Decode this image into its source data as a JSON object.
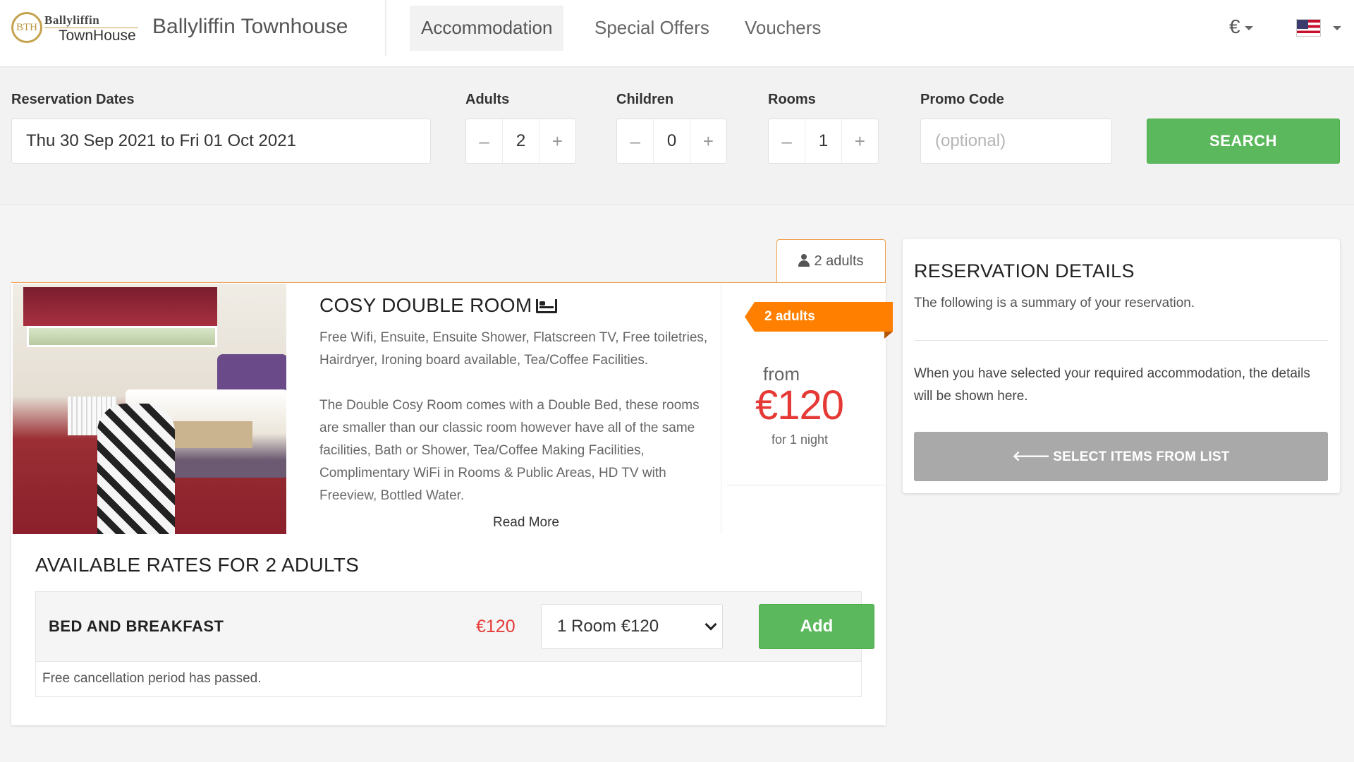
{
  "header": {
    "logo_line1": "Ballyliffin",
    "logo_line2": "TownHouse",
    "logo_seal": "BTH",
    "site_name": "Ballyliffin Townhouse",
    "nav": [
      {
        "label": "Accommodation",
        "active": true
      },
      {
        "label": "Special Offers",
        "active": false
      },
      {
        "label": "Vouchers",
        "active": false
      }
    ],
    "currency": "€",
    "language_icon": "us-flag-icon"
  },
  "search": {
    "dates_label": "Reservation Dates",
    "dates_value": "Thu 30 Sep 2021 to Fri 01 Oct 2021",
    "adults_label": "Adults",
    "adults_value": "2",
    "children_label": "Children",
    "children_value": "0",
    "rooms_label": "Rooms",
    "rooms_value": "1",
    "minus_glyph": "–",
    "plus_glyph": "+",
    "promo_label": "Promo Code",
    "promo_placeholder": "(optional)",
    "promo_value": "",
    "search_button": "SEARCH"
  },
  "room": {
    "occupancy_tab": "2 adults",
    "title": "COSY DOUBLE ROOM",
    "amenities": "Free Wifi, Ensuite, Ensuite Shower, Flatscreen TV, Free toiletries, Hairdryer, Ironing board available, Tea/Coffee Facilities.",
    "description": "The Double Cosy Room comes with a Double Bed, these rooms are smaller than our classic room however have all of the same facilities, Bath or Shower, Tea/Coffee Making Facilities, Complimentary WiFi in Rooms & Public Areas, HD TV with Freeview, Bottled Water.",
    "read_more": "Read More",
    "ribbon": "2 adults",
    "from_label": "from",
    "price": "€120",
    "night_label": "for 1 night",
    "rates_title": "AVAILABLE RATES FOR 2 ADULTS",
    "rate": {
      "name": "BED AND BREAKFAST",
      "price": "€120",
      "selected_option": "1 Room €120",
      "add_button": "Add",
      "cancellation_note": "Free cancellation period has passed."
    }
  },
  "reservation": {
    "title": "RESERVATION DETAILS",
    "subtitle": "The following is a summary of your reservation.",
    "note": "When you have selected your required accommodation, the details will be shown here.",
    "button": "SELECT ITEMS FROM LIST"
  },
  "colors": {
    "accent_green": "#5cb85c",
    "price_red": "#e53935",
    "ribbon_orange": "#ff7f00",
    "disabled_grey": "#a9a9a9"
  }
}
